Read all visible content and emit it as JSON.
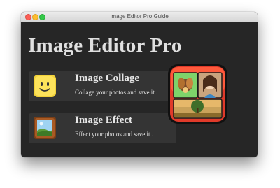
{
  "window": {
    "title": "Image Editor Pro Guide",
    "controls": [
      "close",
      "minimize",
      "zoom"
    ]
  },
  "app_title": "Image Editor Pro",
  "options": [
    {
      "title": "Image Collage",
      "description": "Collage your photos and save it .",
      "icon": "smiley-face-icon"
    },
    {
      "title": "Image Effect",
      "description": "Effect your photos and save it .",
      "icon": "photo-frame-icon"
    }
  ],
  "app_icon": "image-editor-pro-app-icon",
  "colors": {
    "window_bg": "#262626",
    "panel_bg": "#343434",
    "text": "#e0e0e0",
    "icon_red": "#e03a2a",
    "icon_green": "#6ac25a"
  }
}
